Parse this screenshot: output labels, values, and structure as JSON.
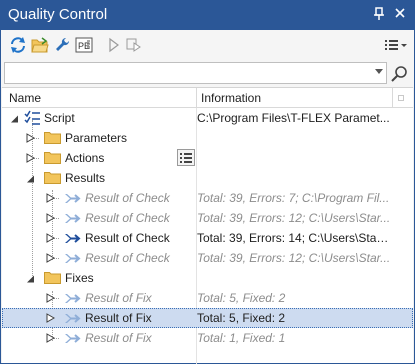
{
  "window": {
    "title": "Quality Control"
  },
  "search": {
    "value": "",
    "placeholder": ""
  },
  "columns": {
    "name": "Name",
    "info": "Information"
  },
  "tree": {
    "script": {
      "label": "Script",
      "info": "C:\\Program Files\\T-FLEX Paramet..."
    },
    "parameters": {
      "label": "Parameters",
      "info": ""
    },
    "actions": {
      "label": "Actions",
      "info": ""
    },
    "results": {
      "label": "Results",
      "info": ""
    },
    "results_items": [
      {
        "label": "Result of Check",
        "info": "Total: 39, Errors: 7; C:\\Program Fil...",
        "dim": true
      },
      {
        "label": "Result of Check",
        "info": "Total: 39, Errors: 12; C:\\Users\\Star...",
        "dim": true
      },
      {
        "label": "Result of Check",
        "info": "Total: 39, Errors: 14; C:\\Users\\Stark...",
        "dim": false
      },
      {
        "label": "Result of Check",
        "info": "Total: 39, Errors: 12; C:\\Users\\Star...",
        "dim": true
      }
    ],
    "fixes": {
      "label": "Fixes",
      "info": ""
    },
    "fixes_items": [
      {
        "label": "Result of Fix",
        "info": "Total: 5, Fixed: 2",
        "dim": true
      },
      {
        "label": "Result of Fix",
        "info": "Total: 5, Fixed: 2",
        "dim": false,
        "selected": true
      },
      {
        "label": "Result of Fix",
        "info": "Total: 1, Fixed: 1",
        "dim": true
      }
    ]
  },
  "colors": {
    "titlebar": "#2b5797",
    "selection": "#cddbf0",
    "folder": "#f2c55c",
    "arrows": "#1f4e9c"
  }
}
